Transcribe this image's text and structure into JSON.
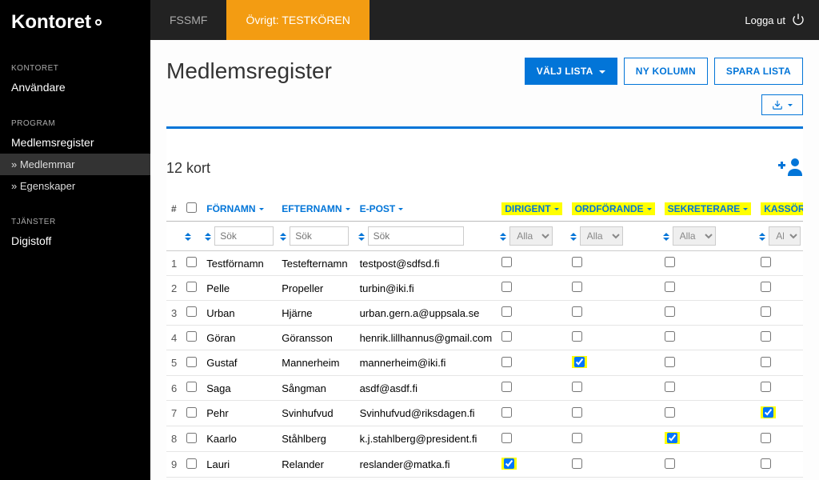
{
  "brand": "Kontoret",
  "sidebar": {
    "groups": [
      {
        "label": "KONTORET",
        "items": [
          {
            "label": "Användare"
          }
        ]
      },
      {
        "label": "PROGRAM",
        "items": [
          {
            "label": "Medlemsregister"
          }
        ],
        "subitems": [
          {
            "label": "» Medlemmar",
            "active": true
          },
          {
            "label": "» Egenskaper",
            "active": false
          }
        ]
      },
      {
        "label": "TJÄNSTER",
        "items": [
          {
            "label": "Digistoff"
          }
        ]
      }
    ]
  },
  "topbar": {
    "tab1": "FSSMF",
    "tab2": "Övrigt: TESTKÖREN",
    "logout": "Logga ut"
  },
  "page": {
    "title": "Medlemsregister",
    "btn_select_list": "VÄLJ LISTA",
    "btn_new_col": "NY KOLUMN",
    "btn_save_list": "SPARA LISTA"
  },
  "panel": {
    "count_label": "12 kort"
  },
  "columns": {
    "num": "#",
    "first": "FÖRNAMN",
    "last": "EFTERNAMN",
    "email": "E-POST",
    "dirigent": "DIRIGENT",
    "ordforande": "ORDFÖRANDE",
    "sekreterare": "SEKRETERARE",
    "kassor": "KASSÖR"
  },
  "filters": {
    "placeholder_text": "Sök",
    "placeholder_select": "Alla"
  },
  "rows": [
    {
      "n": "1",
      "first": "Testförnamn",
      "last": "Testefternamn",
      "email": "testpost@sdfsd.fi",
      "dir": false,
      "ord": false,
      "sek": false,
      "kas": false,
      "hl": []
    },
    {
      "n": "2",
      "first": "Pelle",
      "last": "Propeller",
      "email": "turbin@iki.fi",
      "dir": false,
      "ord": false,
      "sek": false,
      "kas": false,
      "hl": []
    },
    {
      "n": "3",
      "first": "Urban",
      "last": "Hjärne",
      "email": "urban.gern.a@uppsala.se",
      "dir": false,
      "ord": false,
      "sek": false,
      "kas": false,
      "hl": []
    },
    {
      "n": "4",
      "first": "Göran",
      "last": "Göransson",
      "email": "henrik.lillhannus@gmail.com",
      "dir": false,
      "ord": false,
      "sek": false,
      "kas": false,
      "hl": []
    },
    {
      "n": "5",
      "first": "Gustaf",
      "last": "Mannerheim",
      "email": "mannerheim@iki.fi",
      "dir": false,
      "ord": true,
      "sek": false,
      "kas": false,
      "hl": [
        "ord"
      ]
    },
    {
      "n": "6",
      "first": "Saga",
      "last": "Sångman",
      "email": "asdf@asdf.fi",
      "dir": false,
      "ord": false,
      "sek": false,
      "kas": false,
      "hl": []
    },
    {
      "n": "7",
      "first": "Pehr",
      "last": "Svinhufvud",
      "email": "Svinhufvud@riksdagen.fi",
      "dir": false,
      "ord": false,
      "sek": false,
      "kas": true,
      "hl": [
        "kas"
      ]
    },
    {
      "n": "8",
      "first": "Kaarlo",
      "last": "Ståhlberg",
      "email": "k.j.stahlberg@president.fi",
      "dir": false,
      "ord": false,
      "sek": true,
      "kas": false,
      "hl": [
        "sek"
      ]
    },
    {
      "n": "9",
      "first": "Lauri",
      "last": "Relander",
      "email": "reslander@matka.fi",
      "dir": true,
      "ord": false,
      "sek": false,
      "kas": false,
      "hl": [
        "dir"
      ]
    }
  ]
}
